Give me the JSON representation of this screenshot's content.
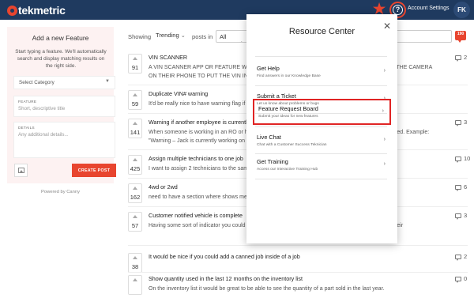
{
  "topbar": {
    "logo_text": "tekmetric",
    "account_label": "Account Settings",
    "avatar_initials": "FK",
    "accent_color": "#e8452f",
    "background_color": "#1f3a5f"
  },
  "new_feature": {
    "title": "Add a new Feature",
    "description": "Start typing a feature. We'll automatically search and display matching results on the right side.",
    "category_placeholder": "Select Category",
    "feature_label": "FEATURE",
    "feature_placeholder": "Short, descriptive title",
    "details_label": "DETAILS",
    "details_placeholder": "Any additional details...",
    "create_button": "CREATE POST",
    "powered_by": "Powered by Canny"
  },
  "filter": {
    "showing_label": "Showing",
    "sort_value": "Trending",
    "posts_in_label": "posts in",
    "category_value": "All Categories",
    "notification_count": "190"
  },
  "posts": [
    {
      "votes": "91",
      "title": "VIN SCANNER",
      "description": "A VIN SCANNER APP OR FEATURE WOULD BE GREAT. OUR TECHS WOULD BE ABLE TO USE THE CAMERA ON THEIR PHONE TO PUT THE VIN INTO THE SYSTEM.",
      "comments": "2"
    },
    {
      "votes": "59",
      "title": "Duplicate VIN# warning",
      "description": "It'd be really nice to have warning flag if a duplicate VIN# is entered",
      "comments": ""
    },
    {
      "votes": "141",
      "title": "Warning if another employee is currently in the RO",
      "description": "When someone is working in an RO or has it open, another user can make changes that are not deleted. Example: \"Warning – Jack is currently working on RO #123, changes made may not be saved.\" Back...",
      "comments": "3"
    },
    {
      "votes": "425",
      "title": "Assign multiple technicians to one job",
      "description": "I want to assign 2 technicians to the same job",
      "comments": "10"
    },
    {
      "votes": "162",
      "title": "4wd or 2wd",
      "description": "need to have a section where shows me if the vehicle is 4wd or 2wd",
      "comments": "6"
    },
    {
      "votes": "57",
      "title": "Customer notified vehicle is complete",
      "description": "Having some sort of indicator you could click on the RO to show that the customer was notified that their",
      "comments": "3"
    },
    {
      "votes": "38",
      "title": "It would be nice if you could add a canned job inside of a job",
      "description": "",
      "comments": "2"
    },
    {
      "votes": "",
      "title": "Show quantity used in the last 12 months on the inventory list",
      "description": "On the inventory list it would be great to be able to see the quantity of a part sold in the last year.",
      "comments": "0"
    }
  ],
  "resource_center": {
    "title": "Resource Center",
    "items": [
      {
        "title": "Get Help",
        "description": "Find answers in our Knowledge Base"
      },
      {
        "title": "Submit a Ticket",
        "description": "Let us know about problems or bugs"
      },
      {
        "title": "Feature Request Board",
        "description": "Submit your ideas for new features"
      },
      {
        "title": "Live Chat",
        "description": "Chat with a Customer Success Teknician"
      },
      {
        "title": "Get Training",
        "description": "Access our Interactive Training Hub"
      }
    ],
    "highlight_color": "#e02424"
  }
}
